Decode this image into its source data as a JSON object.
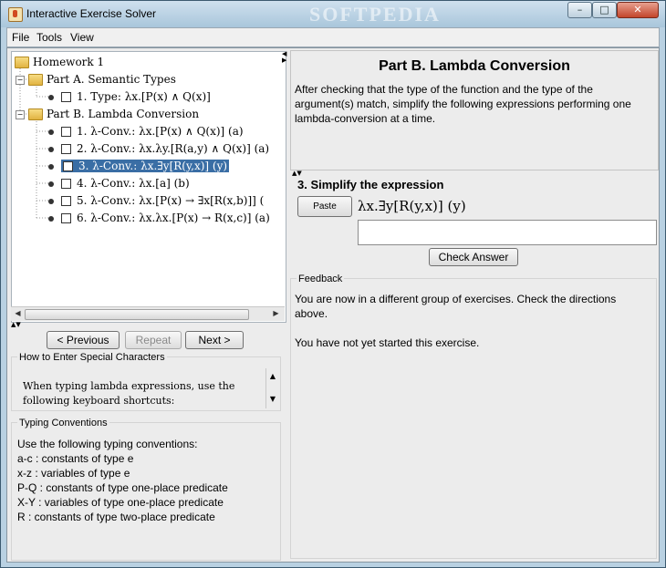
{
  "window": {
    "title": "Interactive Exercise Solver",
    "watermark": "SOFTPEDIA",
    "controls": {
      "minimize": "–",
      "maximize": "□",
      "close": "✕"
    }
  },
  "menu": {
    "file": "File",
    "tools": "Tools",
    "view": "View"
  },
  "tree": {
    "root": "Homework 1",
    "groups": [
      {
        "label": "Part A. Semantic Types",
        "items": [
          "1. Type: λx.[P(x) ∧ Q(x)]"
        ]
      },
      {
        "label": "Part B. Lambda Conversion",
        "items": [
          "1. λ-Conv.: λx.[P(x) ∧ Q(x)] (a)",
          "2. λ-Conv.: λx.λy.[R(a,y) ∧ Q(x)] (a)",
          "3. λ-Conv.: λx.∃y[R(y,x)] (y)",
          "4. λ-Conv.: λx.[a] (b)",
          "5. λ-Conv.: λx.[P(x) → ∃x[R(x,b)]] (",
          "6. λ-Conv.: λx.λx.[P(x) → R(x,c)] (a)"
        ]
      }
    ]
  },
  "nav": {
    "previous": "< Previous",
    "repeat": "Repeat",
    "next": "Next >"
  },
  "special_chars": {
    "title": "How to Enter Special Characters",
    "text_line1": "When typing lambda expressions, use the",
    "text_line2": "following keyboard shortcuts:"
  },
  "conventions": {
    "title": "Typing Conventions",
    "lines": [
      "Use the following typing conventions:",
      "a-c : constants of type e",
      "x-z : variables of type e",
      "P-Q : constants of type one-place predicate",
      "X-Y : variables of type one-place predicate",
      "R : constants of type two-place predicate"
    ]
  },
  "directions": {
    "title": "Part B. Lambda Conversion",
    "line1": "After checking that the type of the function and the type of the",
    "line2": "argument(s) match, simplify the following expressions performing one",
    "line3": "lambda-conversion at a time."
  },
  "exercise": {
    "title": "3. Simplify the expression",
    "paste_label": "Paste",
    "expression": "λx.∃y[R(y,x)] (y)",
    "answer_value": "",
    "check_label": "Check Answer"
  },
  "feedback": {
    "title": "Feedback",
    "line1": "You are now in a different group of exercises. Check the directions",
    "line2": "above.",
    "line3": "You have not yet started this exercise."
  },
  "colors": {
    "selection": "#3a6ea5",
    "titlebar": "#b9d1e2"
  }
}
